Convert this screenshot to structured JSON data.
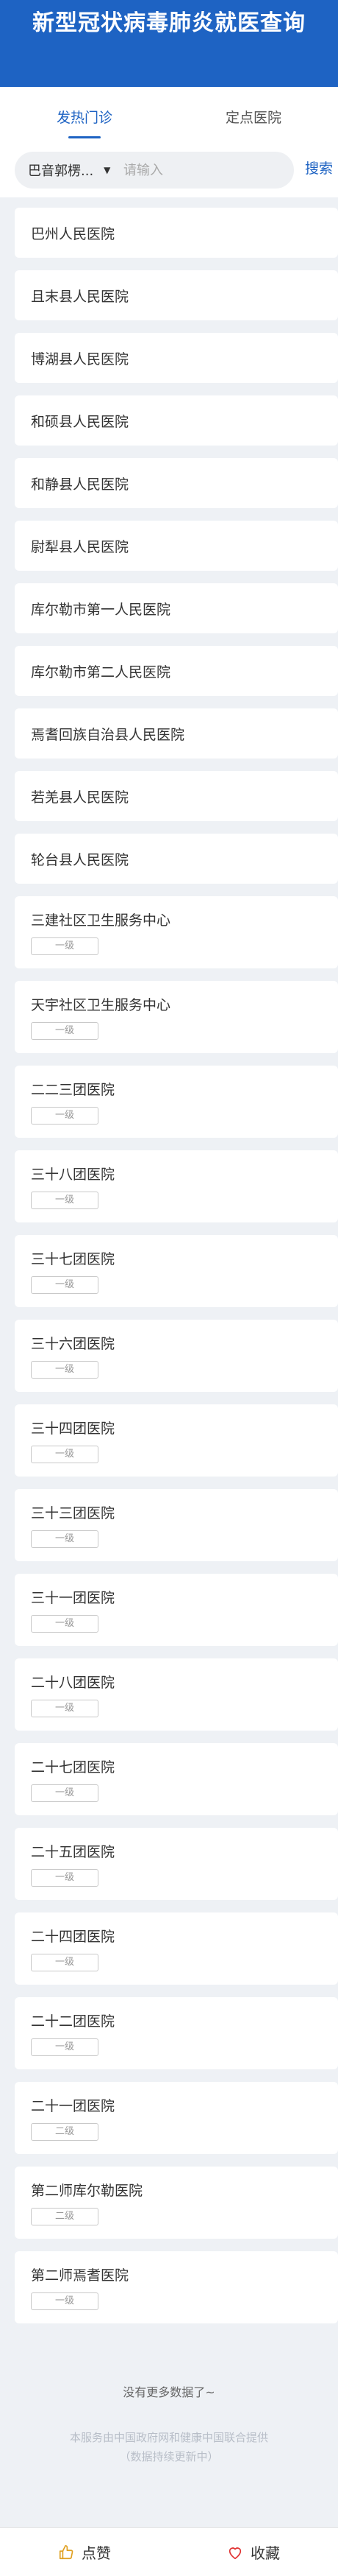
{
  "header": {
    "title": "新型冠状病毒肺炎就医查询"
  },
  "tabs": [
    {
      "label": "发热门诊",
      "active": true
    },
    {
      "label": "定点医院",
      "active": false
    }
  ],
  "search": {
    "region": "巴音郭楞...",
    "placeholder": "请输入",
    "button": "搜索"
  },
  "hospitals": [
    {
      "name": "巴州人民医院",
      "level": ""
    },
    {
      "name": "且末县人民医院",
      "level": ""
    },
    {
      "name": "博湖县人民医院",
      "level": ""
    },
    {
      "name": "和硕县人民医院",
      "level": ""
    },
    {
      "name": "和静县人民医院",
      "level": ""
    },
    {
      "name": "尉犁县人民医院",
      "level": ""
    },
    {
      "name": "库尔勒市第一人民医院",
      "level": ""
    },
    {
      "name": "库尔勒市第二人民医院",
      "level": ""
    },
    {
      "name": "焉耆回族自治县人民医院",
      "level": ""
    },
    {
      "name": "若羌县人民医院",
      "level": ""
    },
    {
      "name": "轮台县人民医院",
      "level": ""
    },
    {
      "name": "三建社区卫生服务中心",
      "level": "一级"
    },
    {
      "name": "天宇社区卫生服务中心",
      "level": "一级"
    },
    {
      "name": "二二三团医院",
      "level": "一级"
    },
    {
      "name": "三十八团医院",
      "level": "一级"
    },
    {
      "name": "三十七团医院",
      "level": "一级"
    },
    {
      "name": "三十六团医院",
      "level": "一级"
    },
    {
      "name": "三十四团医院",
      "level": "一级"
    },
    {
      "name": "三十三团医院",
      "level": "一级"
    },
    {
      "name": "三十一团医院",
      "level": "一级"
    },
    {
      "name": "二十八团医院",
      "level": "一级"
    },
    {
      "name": "二十七团医院",
      "level": "一级"
    },
    {
      "name": "二十五团医院",
      "level": "一级"
    },
    {
      "name": "二十四团医院",
      "level": "一级"
    },
    {
      "name": "二十二团医院",
      "level": "一级"
    },
    {
      "name": "二十一团医院",
      "level": "二级"
    },
    {
      "name": "第二师库尔勒医院",
      "level": "二级"
    },
    {
      "name": "第二师焉耆医院",
      "level": "一级"
    }
  ],
  "list_end": "没有更多数据了~",
  "footnote": [
    "本服务由中国政府网和健康中国联合提供",
    "（数据持续更新中）"
  ],
  "bottom_bar": {
    "like_label": "点赞",
    "favorite_label": "收藏",
    "accent": "#1e63c3"
  }
}
